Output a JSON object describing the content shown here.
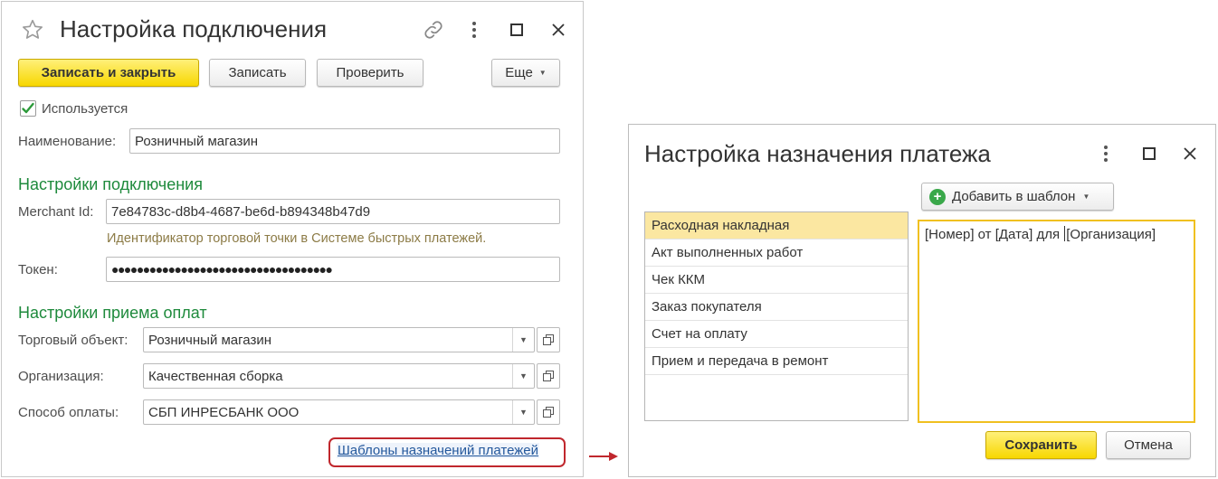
{
  "main": {
    "title": "Настройка подключения",
    "toolbar": {
      "save_close": "Записать и закрыть",
      "save": "Записать",
      "check": "Проверить",
      "more": "Еще"
    },
    "used_label": "Используется",
    "used_checked": true,
    "name_label": "Наименование:",
    "name_value": "Розничный магазин",
    "conn_section": "Настройки подключения",
    "merchant_label": "Merchant Id:",
    "merchant_value": "7e84783c-d8b4-4687-be6d-b894348b47d9",
    "merchant_hint": "Идентификатор торговой точки в Системе быстрых платежей.",
    "token_label": "Токен:",
    "token_value": "●●●●●●●●●●●●●●●●●●●●●●●●●●●●●●●●●●●",
    "pay_section": "Настройки приема оплат",
    "trade_label": "Торговый объект:",
    "trade_value": "Розничный магазин",
    "org_label": "Организация:",
    "org_value": "Качественная сборка",
    "method_label": "Способ оплаты:",
    "method_value": "СБП ИНРЕСБАНК ООО",
    "templates_link": "Шаблоны назначений платежей"
  },
  "dialog": {
    "title": "Настройка назначения платежа",
    "add_button": "Добавить в шаблон",
    "doc_types": [
      "Расходная накладная",
      "Акт выполненных работ",
      "Чек ККМ",
      "Заказ покупателя",
      "Счет на оплату",
      "Прием и передача в ремонт"
    ],
    "template_before_caret": "[Номер] от [Дата] для ",
    "template_after_caret": "[Организация]",
    "save_button": "Сохранить",
    "cancel_button": "Отмена"
  },
  "icons": {
    "star": "star-icon",
    "link": "link-icon",
    "menu": "kebab-menu-icon",
    "maximize": "maximize-icon",
    "close": "close-icon",
    "open": "open-in-window-icon",
    "dropdown": "chevron-down-icon",
    "add": "plus-circle-icon",
    "arrow": "arrow-right-icon"
  },
  "colors": {
    "accent_yellow": "#f7d700",
    "section_green": "#1e8a3c",
    "hint_brown": "#8c7b46",
    "link_blue": "#24589c",
    "highlight_red": "#c0272d",
    "selection": "#fbe7a1"
  }
}
